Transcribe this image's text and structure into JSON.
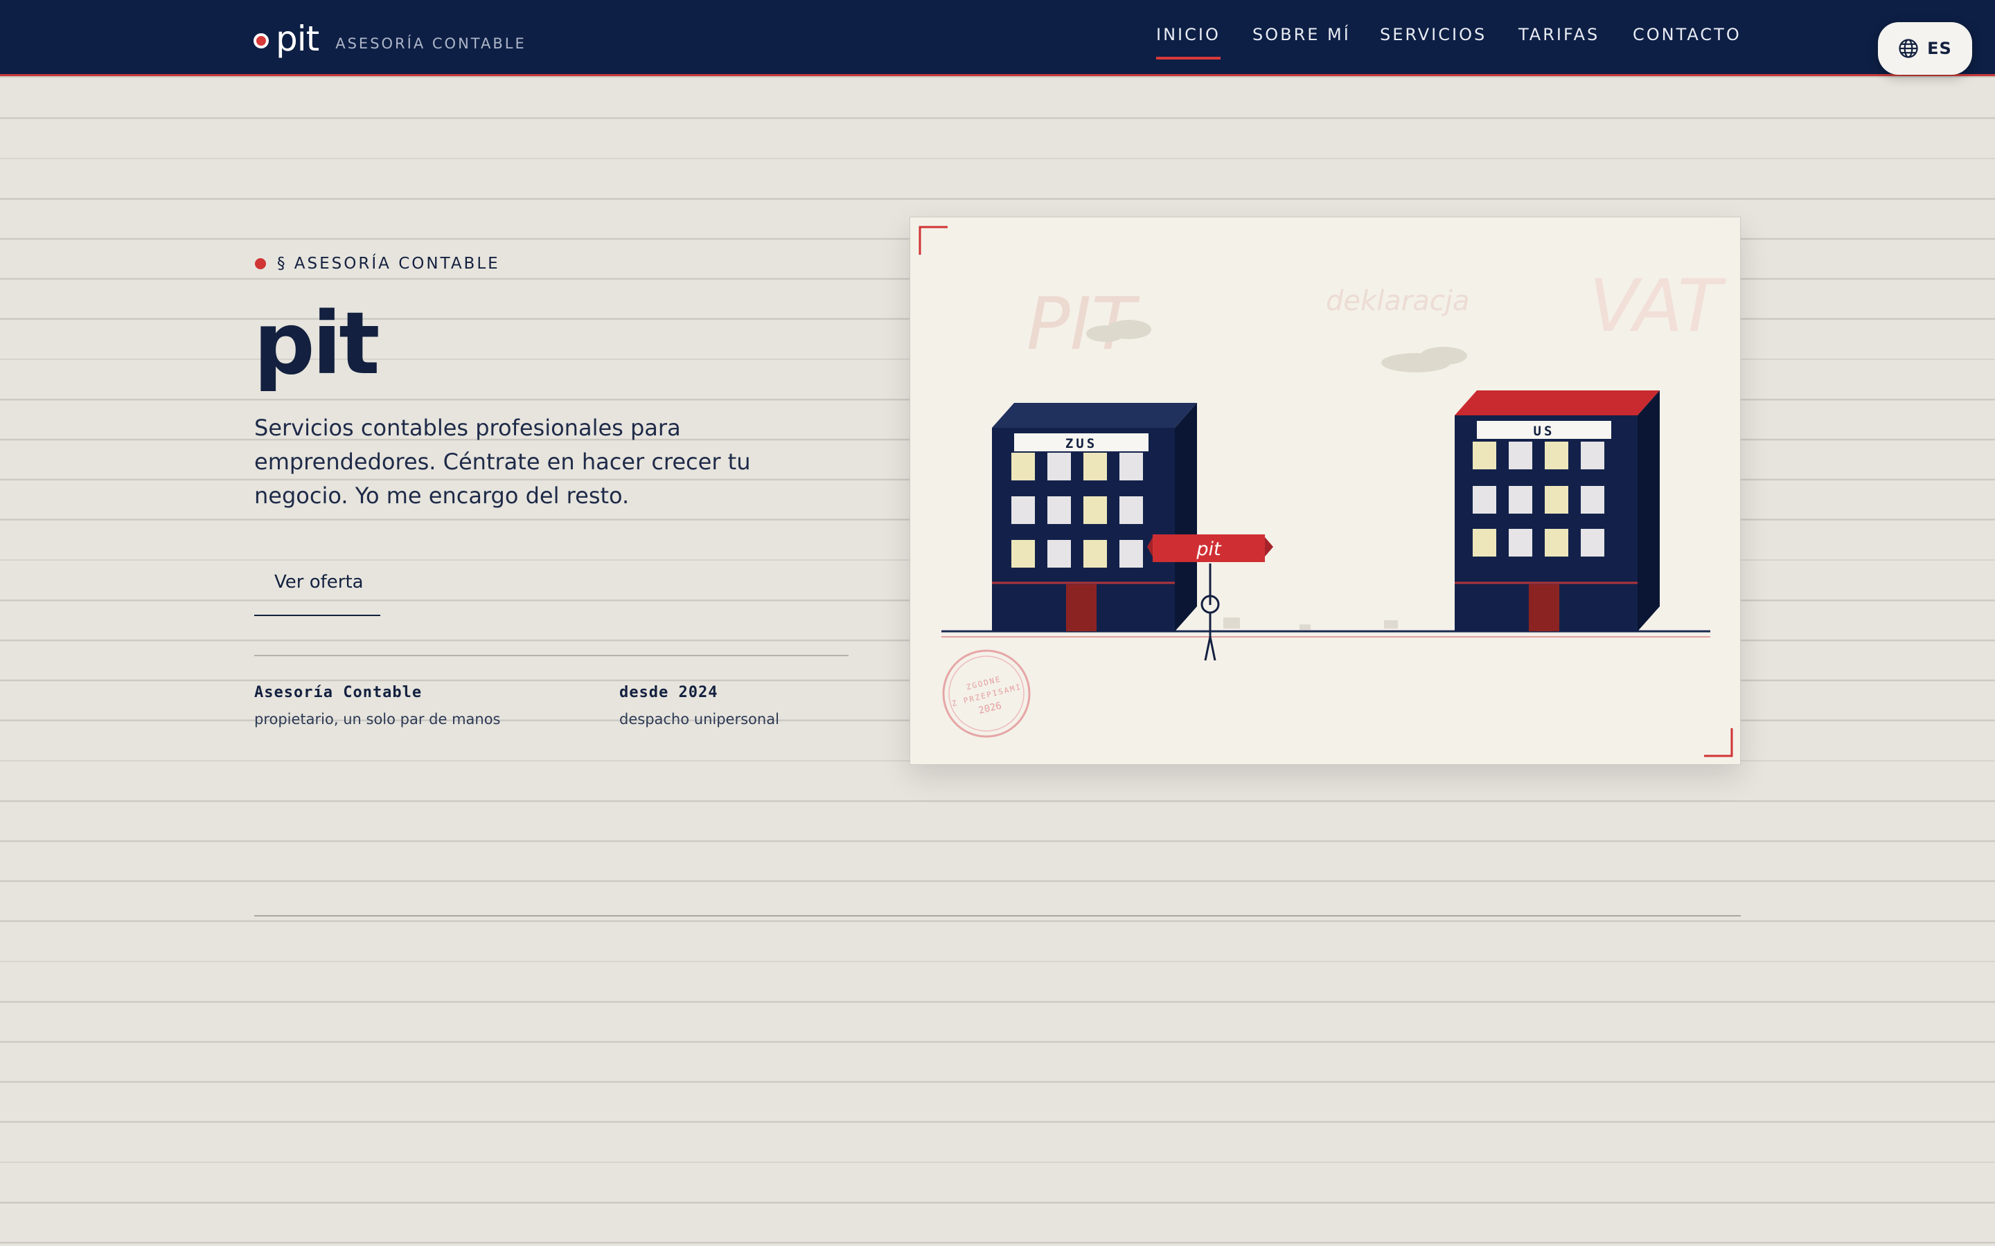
{
  "brand": {
    "name": "pit",
    "subtitle": "ASESORÍA CONTABLE"
  },
  "nav": {
    "items": [
      {
        "label": "INICIO",
        "active": true
      },
      {
        "label": "SOBRE MÍ",
        "active": false
      },
      {
        "label": "SERVICIOS",
        "active": false
      },
      {
        "label": "TARIFAS",
        "active": false
      },
      {
        "label": "CONTACTO",
        "active": false
      }
    ]
  },
  "language": {
    "code": "ES",
    "icon": "globe-icon"
  },
  "hero": {
    "eyebrow": "§ ASESORÍA CONTABLE",
    "title": "pit",
    "description": "Servicios contables profesionales para emprendedores. Céntrate en hacer crecer tu negocio. Yo me encargo del resto.",
    "cta_label": "Ver oferta"
  },
  "meta": [
    {
      "title": "Asesoría Contable",
      "subtitle": "propietario, un solo par de manos"
    },
    {
      "title": "desde 2024",
      "subtitle": "despacho unipersonal"
    }
  ],
  "illustration": {
    "bg_words": [
      "PIT",
      "deklaracja",
      "VAT"
    ],
    "building_left_label": "ZUS",
    "building_right_label": "US",
    "sign_label": "pit",
    "stamp_line1": "ZGODNE",
    "stamp_line2": "Z PRZEPISAMI",
    "stamp_year": "2026"
  },
  "colors": {
    "navy": "#0d1f45",
    "accent_red": "#d03434",
    "paper": "#e6e4dd",
    "card": "#f4f1e9"
  }
}
